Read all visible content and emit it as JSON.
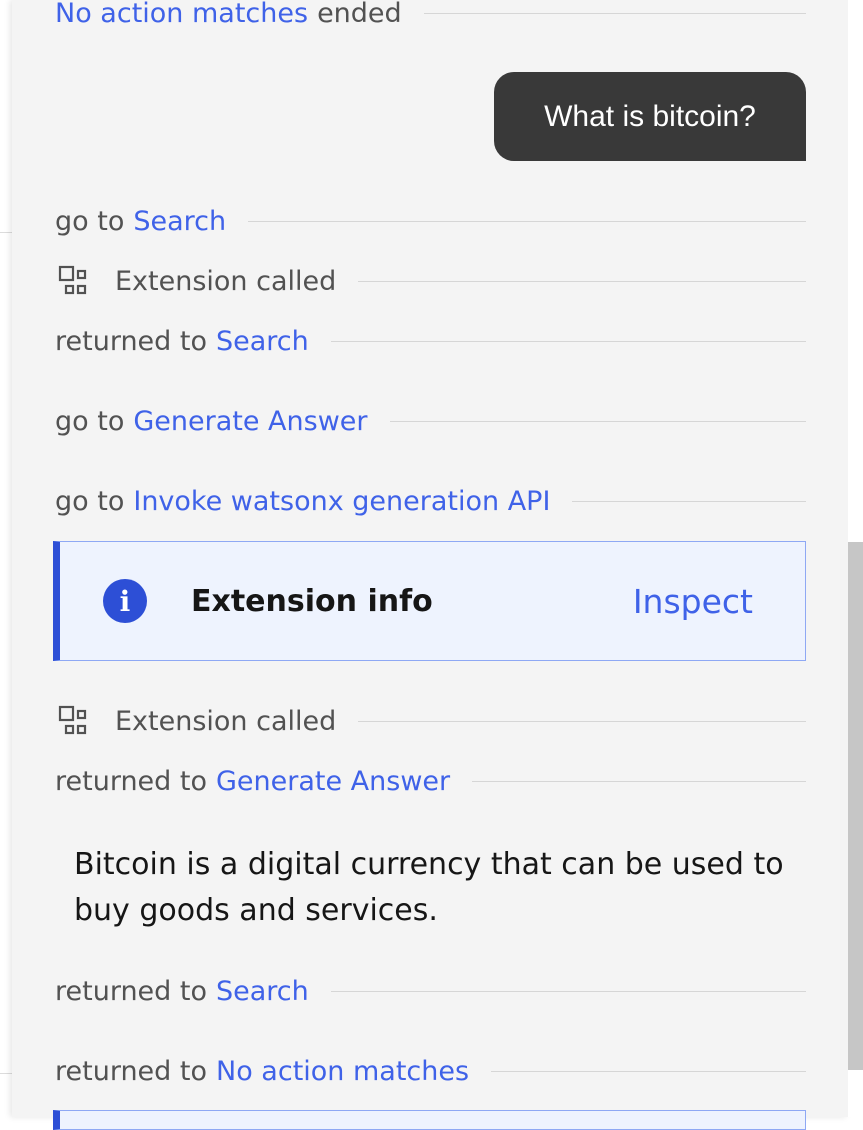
{
  "log": {
    "top_row": {
      "link": "No action matches",
      "suffix": "ended"
    },
    "user_message": "What is bitcoin?",
    "goto_search": {
      "prefix": "go to",
      "link": "Search"
    },
    "extension_called_1": "Extension called",
    "returned_search_1": {
      "prefix": "returned to",
      "link": "Search"
    },
    "goto_generate": {
      "prefix": "go to",
      "link": "Generate Answer"
    },
    "goto_invoke": {
      "prefix": "go to",
      "link": "Invoke watsonx generation API"
    },
    "extension_info": {
      "title": "Extension info",
      "action": "Inspect",
      "icon": "info-icon"
    },
    "extension_called_2": "Extension called",
    "returned_generate": {
      "prefix": "returned to",
      "link": "Generate Answer"
    },
    "answer": "Bitcoin is a digital currency that can be used to buy goods and services.",
    "returned_search_2": {
      "prefix": "returned to",
      "link": "Search"
    },
    "returned_no_action": {
      "prefix": "returned to",
      "link": "No action matches"
    }
  },
  "colors": {
    "link": "#3f62e8",
    "accent": "#2d4fd6",
    "bubble": "#393939",
    "panel": "#f4f4f4"
  }
}
